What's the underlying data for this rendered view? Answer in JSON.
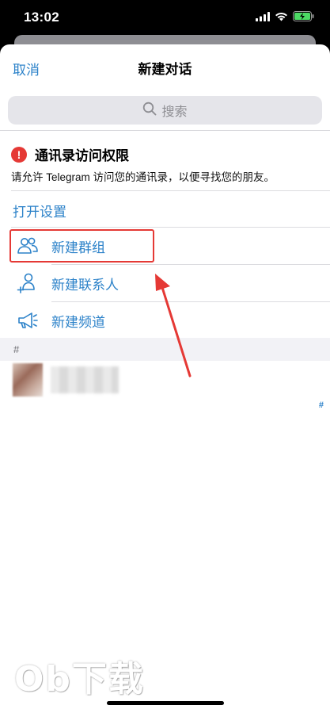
{
  "status_bar": {
    "time": "13:02"
  },
  "nav": {
    "cancel_label": "取消",
    "title": "新建对话"
  },
  "search": {
    "placeholder": "搜索"
  },
  "permission": {
    "title": "通讯录访问权限",
    "description": "请允许 Telegram 访问您的通讯录，以便寻找您的朋友。",
    "alert_symbol": "!",
    "open_settings_label": "打开设置"
  },
  "menu": {
    "items": [
      {
        "label": "新建群组",
        "icon": "group-icon"
      },
      {
        "label": "新建联系人",
        "icon": "add-contact-icon"
      },
      {
        "label": "新建频道",
        "icon": "megaphone-icon"
      }
    ]
  },
  "contacts": {
    "section_header": "#",
    "index_label": "#"
  },
  "watermark": {
    "text": "Ob下载"
  },
  "colors": {
    "accent": "#2c82c9",
    "alert": "#e53935",
    "highlight": "#e53935"
  }
}
